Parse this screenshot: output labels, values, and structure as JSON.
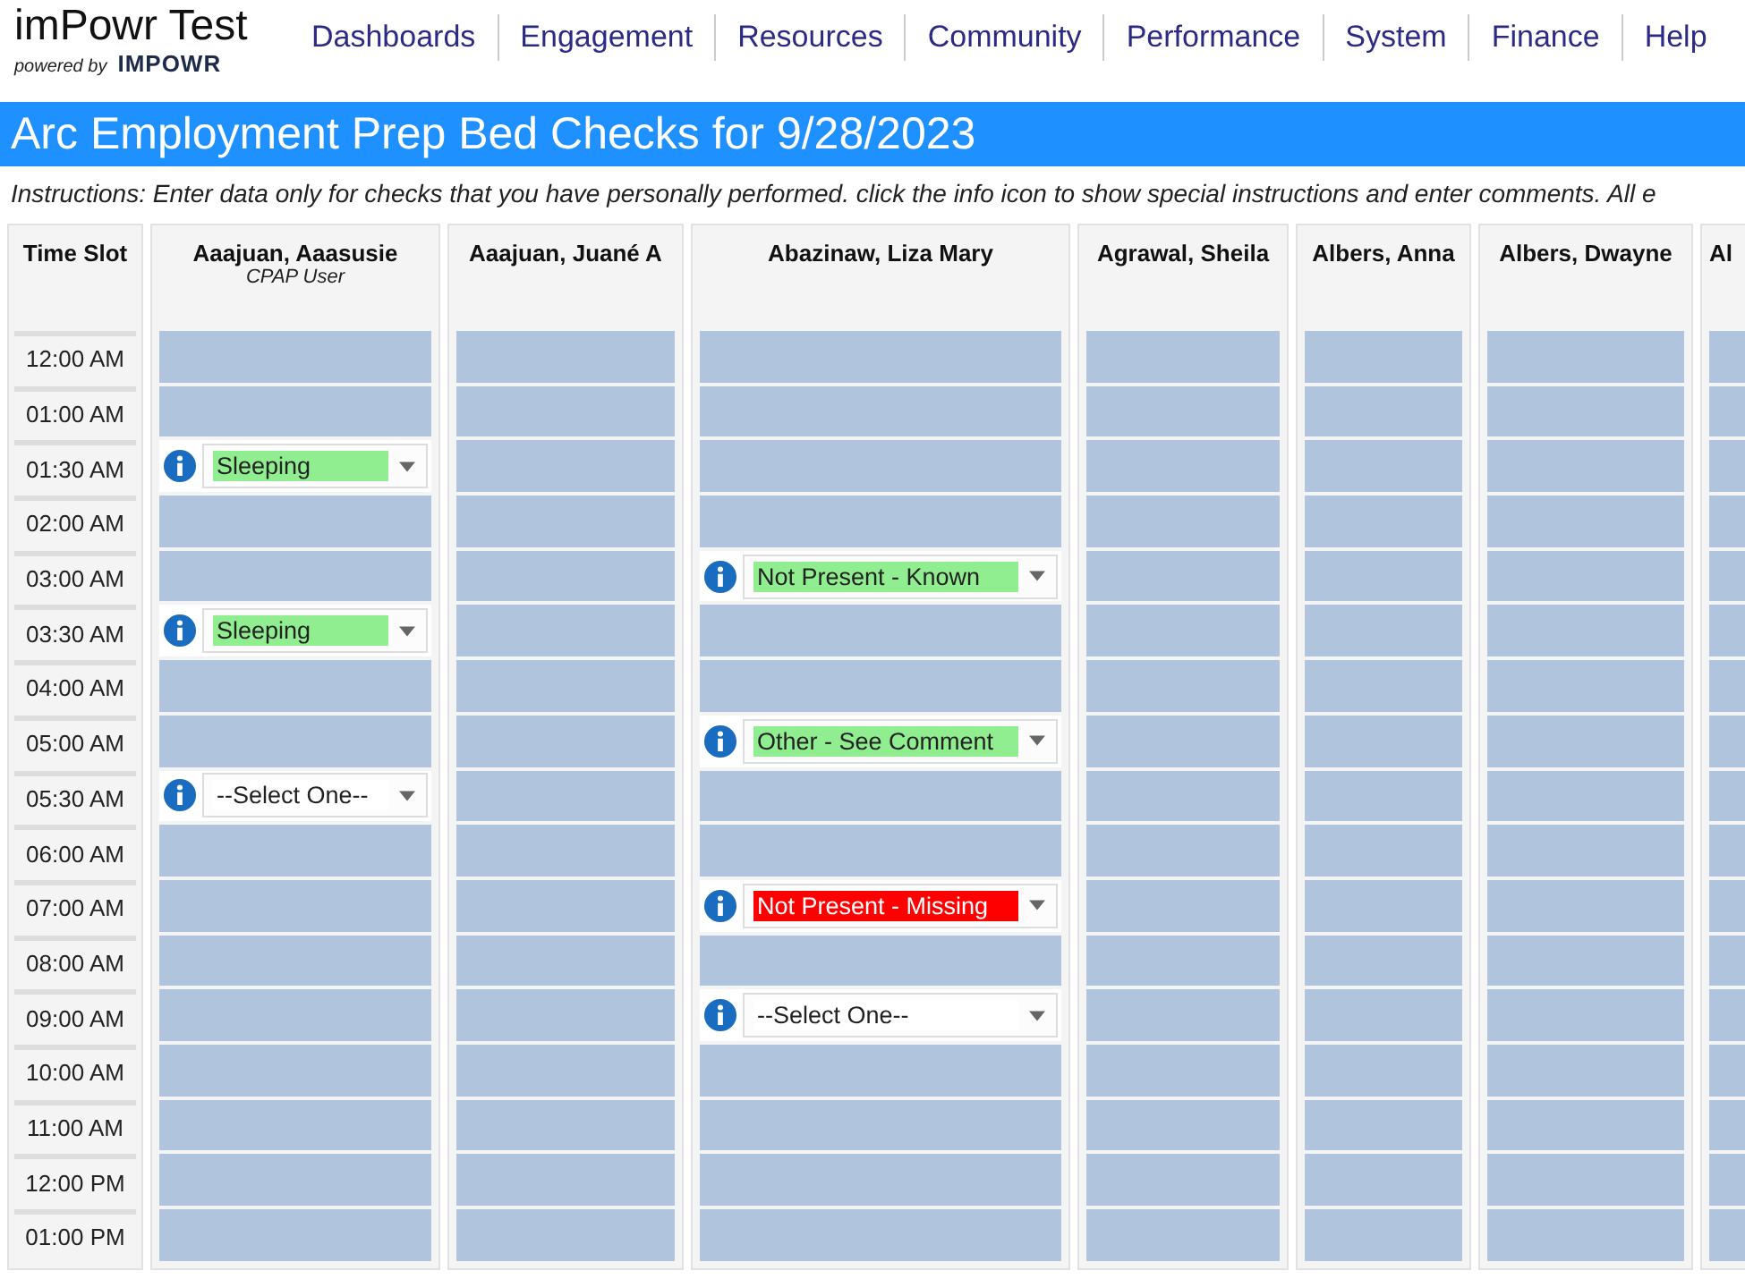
{
  "brand": {
    "title": "imPowr Test",
    "powered_by": "powered by",
    "logo": "IMPOWR"
  },
  "nav": [
    "Dashboards",
    "Engagement",
    "Resources",
    "Community",
    "Performance",
    "System",
    "Finance",
    "Help"
  ],
  "page_title": "Arc Employment Prep Bed Checks for 9/28/2023",
  "instructions": "Instructions: Enter data only for checks that you have personally performed. click the info icon to show special instructions and enter comments. All e",
  "time_header": "Time Slot",
  "columns": [
    {
      "name": "Aaajuan, Aaasusie",
      "note": "CPAP User"
    },
    {
      "name": "Aaajuan, Juané A"
    },
    {
      "name": "Abazinaw, Liza Mary"
    },
    {
      "name": "Agrawal, Sheila"
    },
    {
      "name": "Albers, Anna"
    },
    {
      "name": "Albers, Dwayne"
    },
    {
      "name": "Al"
    }
  ],
  "rows": [
    {
      "time": "12:00 AM",
      "cells": [
        {
          "kind": "blank"
        },
        {
          "kind": "blank"
        },
        {
          "kind": "blank"
        },
        {
          "kind": "blank"
        },
        {
          "kind": "blank"
        },
        {
          "kind": "blank"
        },
        {
          "kind": "blank"
        }
      ]
    },
    {
      "time": "01:00 AM",
      "cells": [
        {
          "kind": "blank"
        },
        {
          "kind": "blank"
        },
        {
          "kind": "blank"
        },
        {
          "kind": "blank"
        },
        {
          "kind": "blank"
        },
        {
          "kind": "blank"
        },
        {
          "kind": "blank"
        }
      ]
    },
    {
      "time": "01:30 AM",
      "cells": [
        {
          "kind": "select",
          "value": "Sleeping",
          "color": "#90ee90"
        },
        {
          "kind": "blank"
        },
        {
          "kind": "blank"
        },
        {
          "kind": "blank"
        },
        {
          "kind": "blank"
        },
        {
          "kind": "blank"
        },
        {
          "kind": "blank"
        }
      ]
    },
    {
      "time": "02:00 AM",
      "cells": [
        {
          "kind": "blank"
        },
        {
          "kind": "blank"
        },
        {
          "kind": "blank"
        },
        {
          "kind": "blank"
        },
        {
          "kind": "blank"
        },
        {
          "kind": "blank"
        },
        {
          "kind": "blank"
        }
      ]
    },
    {
      "time": "03:00 AM",
      "cells": [
        {
          "kind": "blank"
        },
        {
          "kind": "blank"
        },
        {
          "kind": "select",
          "value": "Not Present - Known",
          "color": "#90ee90"
        },
        {
          "kind": "blank"
        },
        {
          "kind": "blank"
        },
        {
          "kind": "blank"
        },
        {
          "kind": "blank"
        }
      ]
    },
    {
      "time": "03:30 AM",
      "cells": [
        {
          "kind": "select",
          "value": "Sleeping",
          "color": "#90ee90"
        },
        {
          "kind": "blank"
        },
        {
          "kind": "blank"
        },
        {
          "kind": "blank"
        },
        {
          "kind": "blank"
        },
        {
          "kind": "blank"
        },
        {
          "kind": "blank"
        }
      ]
    },
    {
      "time": "04:00 AM",
      "cells": [
        {
          "kind": "blank"
        },
        {
          "kind": "blank"
        },
        {
          "kind": "blank"
        },
        {
          "kind": "blank"
        },
        {
          "kind": "blank"
        },
        {
          "kind": "blank"
        },
        {
          "kind": "blank"
        }
      ]
    },
    {
      "time": "05:00 AM",
      "cells": [
        {
          "kind": "blank"
        },
        {
          "kind": "blank"
        },
        {
          "kind": "select",
          "value": "Other - See Comment",
          "color": "#90ee90"
        },
        {
          "kind": "blank"
        },
        {
          "kind": "blank"
        },
        {
          "kind": "blank"
        },
        {
          "kind": "blank"
        }
      ]
    },
    {
      "time": "05:30 AM",
      "cells": [
        {
          "kind": "select",
          "value": "--Select One--"
        },
        {
          "kind": "blank"
        },
        {
          "kind": "blank"
        },
        {
          "kind": "blank"
        },
        {
          "kind": "blank"
        },
        {
          "kind": "blank"
        },
        {
          "kind": "blank"
        }
      ]
    },
    {
      "time": "06:00 AM",
      "cells": [
        {
          "kind": "blank"
        },
        {
          "kind": "blank"
        },
        {
          "kind": "blank"
        },
        {
          "kind": "blank"
        },
        {
          "kind": "blank"
        },
        {
          "kind": "blank"
        },
        {
          "kind": "blank"
        }
      ]
    },
    {
      "time": "07:00 AM",
      "cells": [
        {
          "kind": "blank"
        },
        {
          "kind": "blank"
        },
        {
          "kind": "select",
          "value": "Not Present - Missing",
          "color": "#ff0000"
        },
        {
          "kind": "blank"
        },
        {
          "kind": "blank"
        },
        {
          "kind": "blank"
        },
        {
          "kind": "blank"
        }
      ]
    },
    {
      "time": "08:00 AM",
      "cells": [
        {
          "kind": "blank"
        },
        {
          "kind": "blank"
        },
        {
          "kind": "blank"
        },
        {
          "kind": "blank"
        },
        {
          "kind": "blank"
        },
        {
          "kind": "blank"
        },
        {
          "kind": "blank"
        }
      ]
    },
    {
      "time": "09:00 AM",
      "cells": [
        {
          "kind": "blank"
        },
        {
          "kind": "blank"
        },
        {
          "kind": "select",
          "value": "--Select One--"
        },
        {
          "kind": "blank"
        },
        {
          "kind": "blank"
        },
        {
          "kind": "blank"
        },
        {
          "kind": "blank"
        }
      ]
    },
    {
      "time": "10:00 AM",
      "cells": [
        {
          "kind": "blank"
        },
        {
          "kind": "blank"
        },
        {
          "kind": "blank"
        },
        {
          "kind": "blank"
        },
        {
          "kind": "blank"
        },
        {
          "kind": "blank"
        },
        {
          "kind": "blank"
        }
      ]
    },
    {
      "time": "11:00 AM",
      "cells": [
        {
          "kind": "blank"
        },
        {
          "kind": "blank"
        },
        {
          "kind": "blank"
        },
        {
          "kind": "blank"
        },
        {
          "kind": "blank"
        },
        {
          "kind": "blank"
        },
        {
          "kind": "blank"
        }
      ]
    },
    {
      "time": "12:00 PM",
      "cells": [
        {
          "kind": "blank"
        },
        {
          "kind": "blank"
        },
        {
          "kind": "blank"
        },
        {
          "kind": "blank"
        },
        {
          "kind": "blank"
        },
        {
          "kind": "blank"
        },
        {
          "kind": "blank"
        }
      ]
    },
    {
      "time": "01:00 PM",
      "cells": [
        {
          "kind": "blank"
        },
        {
          "kind": "blank"
        },
        {
          "kind": "blank"
        },
        {
          "kind": "blank"
        },
        {
          "kind": "blank"
        },
        {
          "kind": "blank"
        },
        {
          "kind": "blank"
        }
      ]
    }
  ]
}
